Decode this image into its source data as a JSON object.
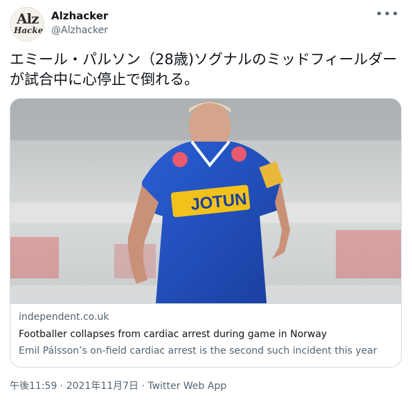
{
  "author": {
    "name": "Alzhacker",
    "handle": "@Alzhacker",
    "avatar_text_top": "Alz",
    "avatar_text_bottom": "Hacker",
    "avatar_icon": "alzhacker-logo-icon"
  },
  "more_icon": "more-options-icon",
  "tweet_text": "エミール・パルソン（28歳)ソグナルのミッドフィールダーが試合中に心停止で倒れる。",
  "card": {
    "image_icon": "football-player-photo",
    "jersey_text": "JOTUN",
    "domain": "independent.co.uk",
    "title": "Footballer collapses from cardiac arrest during game in Norway",
    "description": "Emil Pálsson’s on-field cardiac arrest is the second such incident this year"
  },
  "meta": "午後11:59 · 2021年11月7日 · Twitter Web App",
  "colors": {
    "text_primary": "#0f1419",
    "text_secondary": "#536471",
    "border": "#cfd9de",
    "jersey_blue": "#1f4fc4",
    "sponsor_yellow": "#f2c21b"
  }
}
